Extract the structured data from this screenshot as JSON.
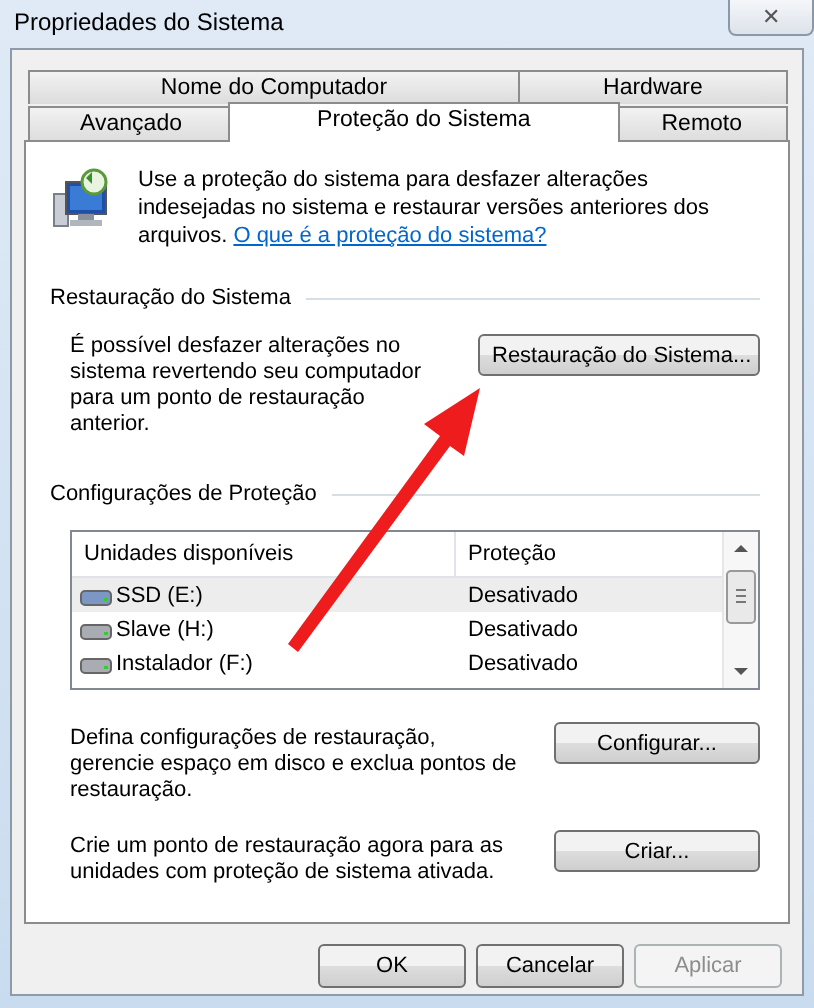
{
  "window": {
    "title": "Propriedades do Sistema",
    "close": "✕"
  },
  "tab_rows": [
    [
      {
        "label": "Nome do Computador",
        "selected": false
      },
      {
        "label": "Hardware",
        "selected": false
      }
    ],
    [
      {
        "label": "Avançado",
        "selected": false
      },
      {
        "label": "Proteção do Sistema",
        "selected": true
      },
      {
        "label": "Remoto",
        "selected": false
      }
    ]
  ],
  "intro": {
    "text": "Use a proteção do sistema para desfazer alterações indesejadas no sistema e restaurar versões anteriores dos arquivos.",
    "link": "O que é a proteção do sistema?"
  },
  "restore_group": {
    "title": "Restauração do Sistema",
    "text": "É possível desfazer alterações no sistema revertendo seu computador para um ponto de restauração anterior.",
    "button": "Restauração do Sistema..."
  },
  "protection_group": {
    "title": "Configurações de Proteção",
    "columns": [
      "Unidades disponíveis",
      "Proteção"
    ],
    "rows": [
      {
        "drive": "SSD (E:)",
        "protection": "Desativado",
        "selected": true
      },
      {
        "drive": "Slave (H:)",
        "protection": "Desativado",
        "selected": false
      },
      {
        "drive": "Instalador (F:)",
        "protection": "Desativado",
        "selected": false
      }
    ],
    "actions": [
      {
        "text": "Defina configurações de restauração, gerencie espaço em disco e exclua pontos de restauração.",
        "button": "Configurar..."
      },
      {
        "text": "Crie um ponto de restauração agora para as unidades com proteção de sistema ativada.",
        "button": "Criar..."
      }
    ]
  },
  "buttons": [
    {
      "label": "OK",
      "disabled": false
    },
    {
      "label": "Cancelar",
      "disabled": false
    },
    {
      "label": "Aplicar",
      "disabled": true
    }
  ]
}
